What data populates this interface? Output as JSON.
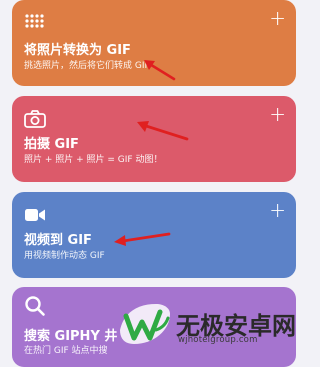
{
  "colors": {
    "card_1": "#de7d44",
    "card_2": "#dc5a6a",
    "card_3": "#5c82c8",
    "card_4": "#a574cf",
    "arrow": "#e02020",
    "watermark_green": "#2faa44"
  },
  "cards": [
    {
      "icon": "grid-dots-icon",
      "title": "将照片转换为 GIF",
      "subtitle": "挑选照片，然后将它们转成 GIF",
      "action": "+"
    },
    {
      "icon": "camera-icon",
      "title": "拍摄 GIF",
      "subtitle": "照片 + 照片 + 照片 = GIF 动图！",
      "action": "+"
    },
    {
      "icon": "video-camera-icon",
      "title": "视频到 GIF",
      "subtitle": "用视频制作动态 GIF",
      "action": "+"
    },
    {
      "icon": "search-icon",
      "title": "搜索 GIPHY 井",
      "subtitle": "在热门 GIF 站点中搜"
    }
  ],
  "watermark": {
    "name": "无极安卓网",
    "url": "wjhotelgroup.com",
    "icon": "wj-logo-icon"
  }
}
